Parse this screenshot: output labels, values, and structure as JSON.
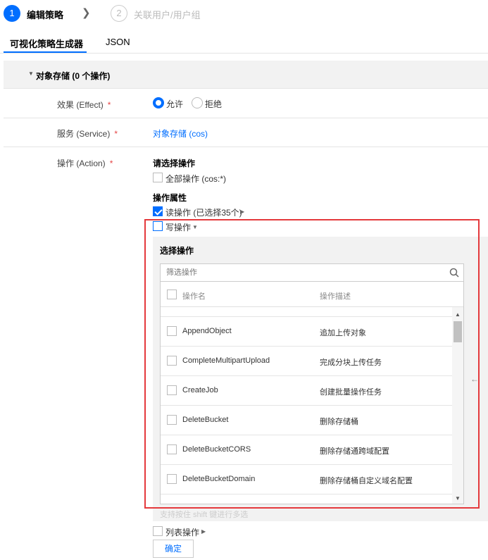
{
  "steps": [
    {
      "num": "1",
      "label": "编辑策略"
    },
    {
      "num": "2",
      "label": "关联用户/用户组"
    }
  ],
  "tabs": {
    "visual": "可视化策略生成器",
    "json": "JSON"
  },
  "section": {
    "title": "对象存储 (0 个操作)"
  },
  "effect": {
    "label": "效果 (Effect)",
    "required": "*",
    "allow": "允许",
    "deny": "拒绝",
    "selected": "允许"
  },
  "service": {
    "label": "服务 (Service)",
    "required": "*",
    "value": "对象存储 (cos)"
  },
  "action": {
    "label": "操作 (Action)",
    "required": "*",
    "choose_title": "请选择操作",
    "all_ops": "全部操作 (cos:*)",
    "attr_title": "操作属性",
    "read_ops": "读操作 (已选择35个)",
    "write_ops": "写操作",
    "list_ops": "列表操作"
  },
  "write_panel": {
    "title": "选择操作",
    "filter_placeholder": "筛选操作",
    "col_name": "操作名",
    "col_desc": "操作描述",
    "rows": [
      {
        "name": "AppendObject",
        "desc": "追加上传对象"
      },
      {
        "name": "CompleteMultipartUpload",
        "desc": "完成分块上传任务"
      },
      {
        "name": "CreateJob",
        "desc": "创建批量操作任务"
      },
      {
        "name": "DeleteBucket",
        "desc": "删除存储桶"
      },
      {
        "name": "DeleteBucketCORS",
        "desc": "删除存储通跨域配置"
      },
      {
        "name": "DeleteBucketDomain",
        "desc": "删除存储桶自定义域名配置"
      }
    ],
    "hint": "支持按住 shift 键进行多选"
  },
  "confirm_label": "确定",
  "colors": {
    "accent": "#006eff",
    "highlight_border": "#e4393c",
    "required": "#e54545"
  }
}
